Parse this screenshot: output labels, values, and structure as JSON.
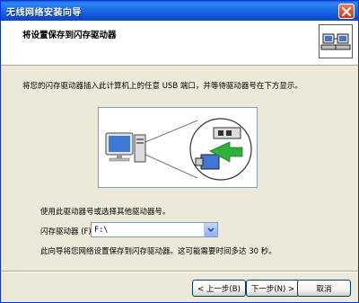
{
  "window": {
    "title": "无线网络安装向导",
    "close_icon": "close-icon"
  },
  "header": {
    "title": "将设置保存到闪存驱动器",
    "icon": "network-computers-icon"
  },
  "body": {
    "instruction": "将您的闪存驱动器插入此计算机上的任意 USB 端口，并等待驱动器号在下方显示。",
    "use_text": "使用此驱动器号或选择其他驱动器号。",
    "drive_label": "闪存驱动器 (F):",
    "drive_value": "F:\\",
    "note": "此向导将您网络设置保存到闪存驱动器。这可能需要时间多达 30 秒。"
  },
  "illustration": {
    "computer_icon": "computer-icon",
    "usb_icon": "usb-icon",
    "arrow_color": "#2fb03a"
  },
  "buttons": {
    "back": "< 上一步(B)",
    "next": "下一步(N) >",
    "cancel": "取消"
  }
}
